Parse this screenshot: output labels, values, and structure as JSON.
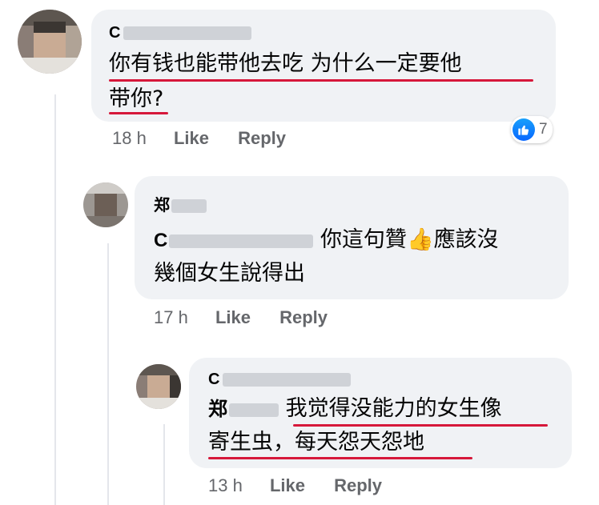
{
  "comments": [
    {
      "author_initial": "C",
      "text_line1": "你有钱也能带他去吃 为什么一定要他",
      "text_line2": "带你?",
      "time": "18 h",
      "like": "Like",
      "reply": "Reply",
      "reaction_count": "7",
      "reaction_icon": "thumbs-up-icon",
      "underline_color": "#d6183a"
    },
    {
      "author_initial": "郑",
      "mention_initial": "C",
      "text_line1": "你這句贊",
      "emoji": "👍",
      "text_line1_end": "應該沒",
      "text_line2": "幾個女生說得出",
      "time": "17 h",
      "like": "Like",
      "reply": "Reply"
    },
    {
      "author_initial": "C",
      "mention_initial": "郑",
      "text_line1": "我觉得没能力的女生像",
      "text_line2": "寄生虫，每天怨天怨地",
      "time": "13 h",
      "like": "Like",
      "reply": "Reply",
      "underline_color": "#d6183a"
    }
  ],
  "colors": {
    "bubble": "#f0f2f5",
    "meta": "#65676b",
    "like_blue": "#0866ff"
  }
}
